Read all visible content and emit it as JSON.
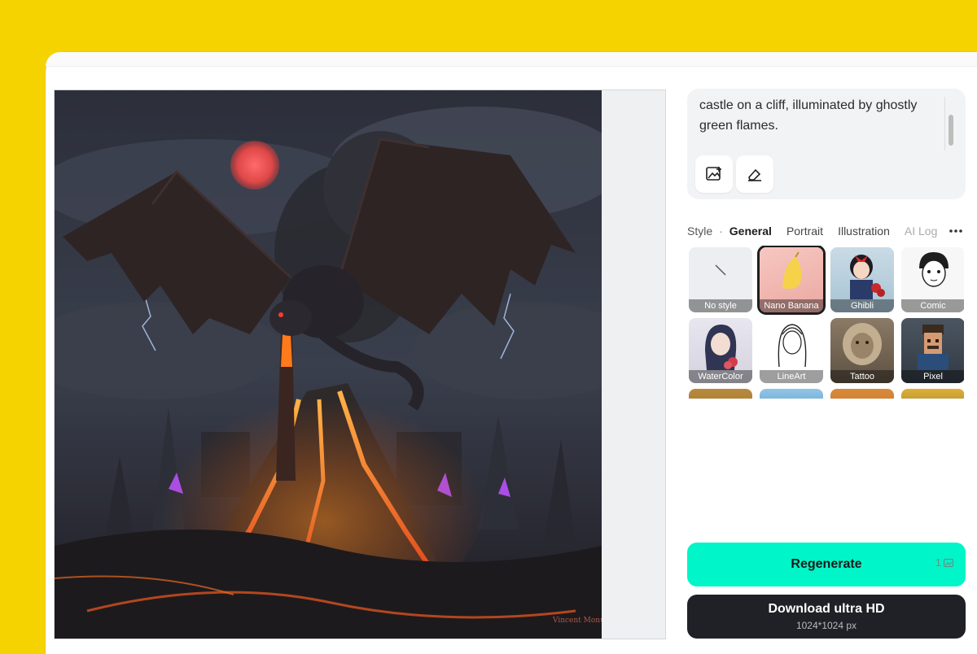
{
  "prompt": {
    "text": "castle on a cliff, illuminated by ghostly green flames."
  },
  "tools": {
    "image_upload_icon": "image-upload-icon",
    "edit_icon": "eraser-edit-icon"
  },
  "style_tabs": {
    "label": "Style",
    "separator": "·",
    "items": [
      "General",
      "Portrait",
      "Illustration",
      "AI Log"
    ],
    "active": "General"
  },
  "styles": [
    {
      "label": "No style"
    },
    {
      "label": "Nano Banana"
    },
    {
      "label": "Ghibli"
    },
    {
      "label": "Comic"
    },
    {
      "label": "WaterColor"
    },
    {
      "label": "LineArt"
    },
    {
      "label": "Tattoo"
    },
    {
      "label": "Pixel"
    }
  ],
  "actions": {
    "regenerate_label": "Regenerate",
    "regenerate_credits": "1",
    "download_label": "Download ultra HD",
    "download_resolution": "1024*1024 px"
  },
  "artwork": {
    "signature": "Vincent Monus"
  },
  "colors": {
    "background": "#f5d300",
    "accent": "#00f5c8",
    "dark_button": "#1f2127"
  }
}
